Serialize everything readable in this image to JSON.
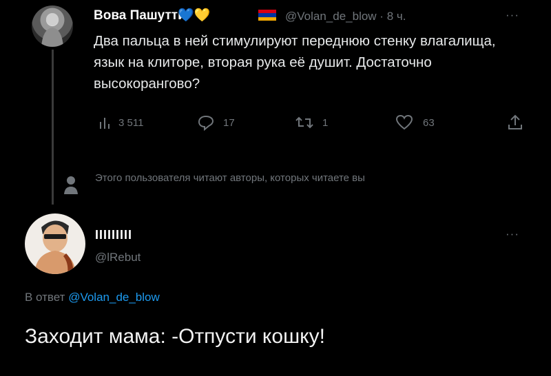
{
  "tweet": {
    "author_name": "Вова Пашутти",
    "hearts": "💙💛",
    "flag_colors": [
      "#d90012",
      "#0033a0",
      "#f2a800"
    ],
    "handle_time": "@Volan_de_blow · 8 ч.",
    "more_icon": "···",
    "text": "Два пальца в ней стимулируют переднюю стенку влагалища, язык на клиторе, вторая рука её душит. Достаточно высокорангово?",
    "actions": {
      "views": "3 511",
      "replies": "17",
      "retweets": "1",
      "likes": "63"
    }
  },
  "muted_notice": {
    "icon": "person-icon",
    "text": "Этого пользователя читают авторы, которых читаете вы"
  },
  "reply": {
    "author_name": "IIIIIIIII",
    "handle": "@lRebut",
    "more_icon": "···",
    "reply_prefix": "В ответ",
    "reply_to": "@Volan_de_blow",
    "text": "Заходит мама: -Отпусти кошку!"
  },
  "colors": {
    "background": "#000000",
    "muted": "#71767b",
    "link": "#1d9bf0"
  }
}
